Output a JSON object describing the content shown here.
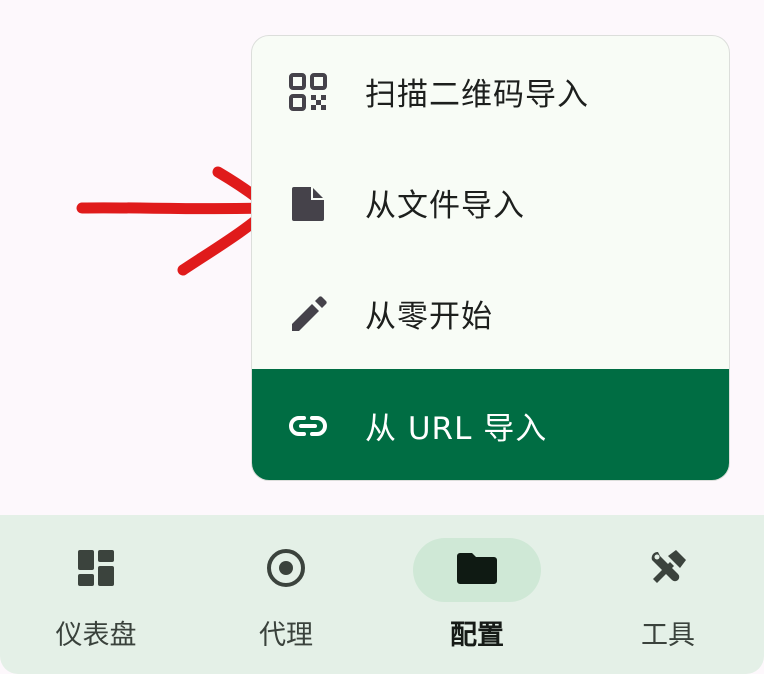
{
  "menu": {
    "items": [
      {
        "icon": "qr-code-icon",
        "label": "扫描二维码导入"
      },
      {
        "icon": "file-icon",
        "label": "从文件导入"
      },
      {
        "icon": "pencil-icon",
        "label": "从零开始"
      },
      {
        "icon": "link-icon",
        "label": "从 URL 导入"
      }
    ],
    "active_index": 3,
    "active_color": "#006d43"
  },
  "annotation": {
    "icon": "red-arrow-icon",
    "color": "#e01b1b"
  },
  "bottom_nav": {
    "items": [
      {
        "icon": "dashboard-icon",
        "label": "仪表盘"
      },
      {
        "icon": "radio-button-icon",
        "label": "代理"
      },
      {
        "icon": "folder-icon",
        "label": "配置"
      },
      {
        "icon": "tools-icon",
        "label": "工具"
      }
    ],
    "selected_index": 2
  }
}
